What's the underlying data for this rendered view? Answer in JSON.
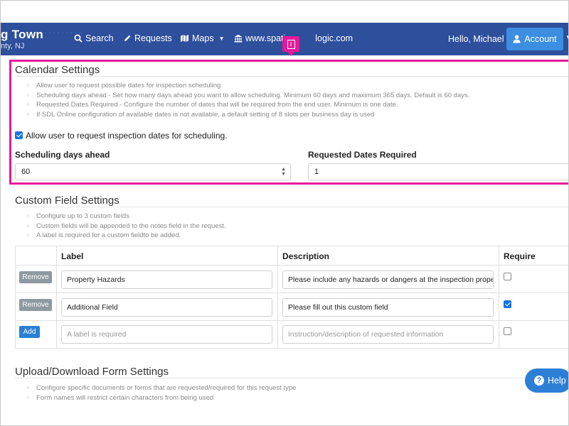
{
  "brand": {
    "title": "g Town",
    "subtitle": "nty, NJ"
  },
  "nav": {
    "search": "Search",
    "requests": "Requests",
    "maps": "Maps",
    "website": "www.spati",
    "website_tail": "logic.com",
    "hello": "Hello, Michael",
    "account": "Account"
  },
  "calendar": {
    "title": "Calendar Settings",
    "bullets": [
      "Allow user to request possible dates for inspection scheduling",
      "Scheduling days ahead - Set how many days ahead you want to allow scheduling. Minimum 60 days and maximum 365 days. Default is 60 days.",
      "Requested Dates Required - Configure the number of dates that will be required from the end user. Minimum is one date.",
      "If SDL Online configuration of available dates is not available, a default setting of 8 slots per business day is used"
    ],
    "allow_label": "Allow user to request inspection dates for scheduling.",
    "allow_checked": true,
    "days_ahead_label": "Scheduling days ahead",
    "days_ahead_value": "60",
    "dates_required_label": "Requested Dates Required",
    "dates_required_value": "1"
  },
  "custom": {
    "title": "Custom Field Settings",
    "bullets": [
      "Configure up to 3 custom fields",
      "Custom fields will be appended to the notes field in the request.",
      "A label is required for a custom fieldto be added."
    ],
    "headers": {
      "label": "Label",
      "description": "Description",
      "require": "Require"
    },
    "rows": [
      {
        "action": "Remove",
        "label": "Property Hazards",
        "description": "Please include any hazards or dangers at the inspection property su",
        "required": false
      },
      {
        "action": "Remove",
        "label": "Additional Field",
        "description": "Please fill out this custom field",
        "required": true
      }
    ],
    "new_row": {
      "action": "Add",
      "label_placeholder": "A label is required",
      "description_placeholder": "Instruction/description of requested information",
      "required": false
    }
  },
  "upload": {
    "title": "Upload/Download Form Settings",
    "bullets": [
      "Configure specific documents or forms that are requested/required for this request type",
      "Form names will restrict certain characters from being used"
    ]
  },
  "help": {
    "label": "Help"
  },
  "colors": {
    "navbar": "#2d4f9c",
    "highlight": "#e6199b",
    "primary": "#2a7fd4",
    "remove": "#8e9aa0"
  }
}
